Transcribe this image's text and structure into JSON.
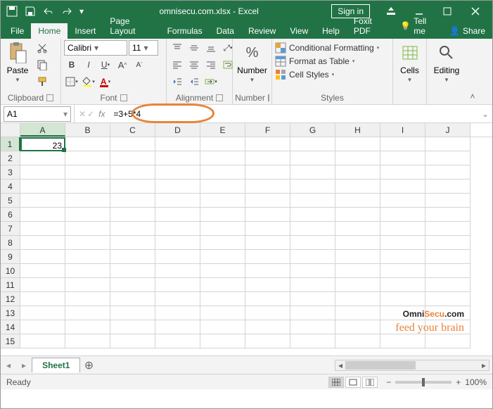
{
  "title": "omnisecu.com.xlsx - Excel",
  "signin": "Sign in",
  "tabs": [
    "File",
    "Home",
    "Insert",
    "Page Layout",
    "Formulas",
    "Data",
    "Review",
    "View",
    "Help",
    "Foxit PDF"
  ],
  "active_tab": 1,
  "tellme": "Tell me",
  "share": "Share",
  "ribbon": {
    "clipboard": {
      "label": "Clipboard",
      "paste": "Paste"
    },
    "font": {
      "label": "Font",
      "name": "Calibri",
      "size": "11"
    },
    "alignment": {
      "label": "Alignment"
    },
    "number": {
      "label": "Number",
      "btn": "Number"
    },
    "styles": {
      "label": "Styles",
      "cond": "Conditional Formatting",
      "table": "Format as Table",
      "cell": "Cell Styles"
    },
    "cells": {
      "label": "Cells",
      "btn": "Cells"
    },
    "editing": {
      "label": "Editing",
      "btn": "Editing"
    }
  },
  "namebox": "A1",
  "formula": "=3+5*4",
  "columns": [
    "A",
    "B",
    "C",
    "D",
    "E",
    "F",
    "G",
    "H",
    "I",
    "J"
  ],
  "rows": 15,
  "active_cell": {
    "row": 0,
    "col": 0,
    "value": "23"
  },
  "sheet": {
    "name": "Sheet1"
  },
  "status": "Ready",
  "zoom": "100%",
  "watermark": {
    "l1a": "Omni",
    "l1b": "Secu",
    "l1c": ".com",
    "l2": "feed your brain"
  }
}
